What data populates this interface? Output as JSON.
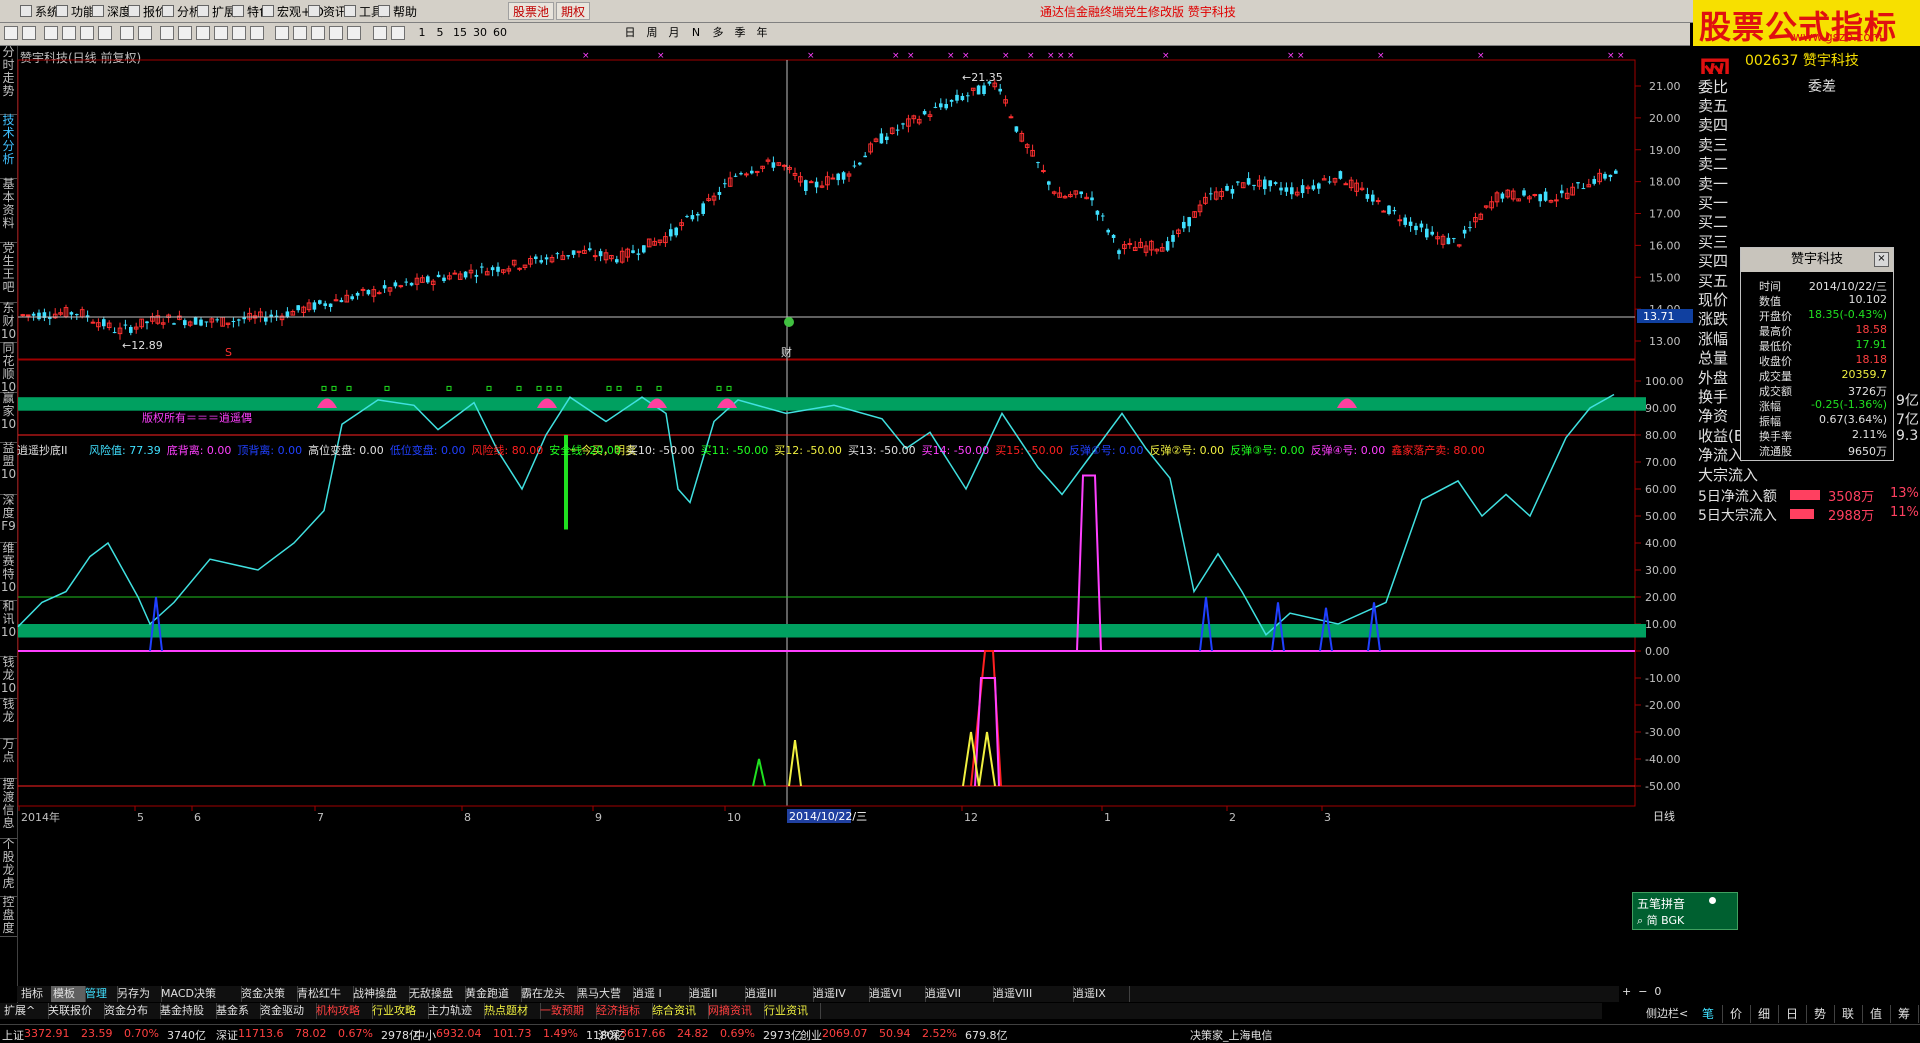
{
  "menu": {
    "items": [
      "系统",
      "功能",
      "深度",
      "报价",
      "分析",
      "扩展",
      "特色",
      "宏观+ID",
      "资讯",
      "工具",
      "帮助"
    ],
    "tab_stockpool": "股票池",
    "tab_options": "期权",
    "app_title": "通达信金融终端党生修改版    赞宇科技"
  },
  "logo": {
    "text": "股票公式指标网",
    "url": "www.gszb.com"
  },
  "toolbar": {
    "periods": [
      "1",
      "5",
      "15",
      "30",
      "60"
    ],
    "periods2": [
      "日",
      "周",
      "月",
      "N",
      "多",
      "季",
      "年"
    ]
  },
  "sidebar": {
    "tabs": [
      "分时走势",
      "技术分析",
      "基本资料",
      "党生王吧",
      "东财10",
      "同花顺10",
      "赢家10",
      "益盟10",
      "深度F9",
      "维赛特10",
      "和讯10",
      "钱龙10",
      "钱龙",
      "万点",
      "摆渡信息",
      "个股龙虎",
      "控盘度"
    ]
  },
  "chart": {
    "title": "赞宇科技(日线 前复权)",
    "stock_header": "002637 赞宇科技",
    "high_label": "21.35",
    "low_label": "12.89",
    "current_price_tag": "13.71",
    "price_axis": [
      "21.00",
      "20.00",
      "19.00",
      "18.00",
      "17.00",
      "16.00",
      "15.00",
      "14.00",
      "13.00"
    ],
    "marker_s": "S",
    "marker_cai": "财"
  },
  "indicator": {
    "name": "逍遥抄底II",
    "params": [
      {
        "text": "风险值: 77.39",
        "color": "#40e0ff"
      },
      {
        "text": "底背离: 0.00",
        "color": "#ff40ff"
      },
      {
        "text": "顶背离: 0.00",
        "color": "#2040ff"
      },
      {
        "text": "高位变盘: 0.00",
        "color": "#e0e0e0"
      },
      {
        "text": "低位变盘: 0.00",
        "color": "#2040ff"
      },
      {
        "text": "风险线: 80.00",
        "color": "#ff2020"
      },
      {
        "text": "安全线: 20.00",
        "color": "#20ff20"
      },
      {
        "text": "买10: -50.00",
        "color": "#e0e0e0"
      },
      {
        "text": "买11: -50.00",
        "color": "#20ff20"
      },
      {
        "text": "买12: -50.00",
        "color": "#f0f040"
      },
      {
        "text": "买13: -50.00",
        "color": "#e0e0e0"
      },
      {
        "text": "买14: -50.00",
        "color": "#ff40ff"
      },
      {
        "text": "买15: -50.00",
        "color": "#ff2020"
      },
      {
        "text": "反弹①号: 0.00",
        "color": "#2040ff"
      },
      {
        "text": "反弹②号: 0.00",
        "color": "#f0f040"
      },
      {
        "text": "反弹③号: 0.00",
        "color": "#20ff20"
      },
      {
        "text": "反弹④号: 0.00",
        "color": "#ff40ff"
      },
      {
        "text": "鑫家落产卖: 80.00",
        "color": "#ff2020"
      }
    ],
    "copyright": "版权所有＝＝＝逍遥偶",
    "sell_note": "一今买，明卖",
    "axis": [
      "100.00",
      "90.00",
      "80.00",
      "70.00",
      "60.00",
      "50.00",
      "40.00",
      "30.00",
      "20.00",
      "10.00",
      "0.00",
      "-10.00",
      "-20.00",
      "-30.00",
      "-40.00",
      "-50.00"
    ]
  },
  "timeaxis": {
    "labels": [
      "2014年",
      "5",
      "6",
      "7",
      "8",
      "9",
      "10",
      "12",
      "1",
      "2",
      "3"
    ],
    "cursor_date": "2014/10/22/三",
    "dayline": "日线"
  },
  "rightpanel": {
    "head1": "委比",
    "head2": "委差",
    "rows": [
      "卖五",
      "卖四",
      "卖三",
      "卖二",
      "卖一",
      "买一",
      "买二",
      "买三",
      "买四",
      "买五",
      "现价",
      "涨跌",
      "涨幅",
      "总量",
      "外盘",
      "换手",
      "净资",
      "收益(B)",
      "净流入",
      "大宗流入"
    ],
    "side_vals": [
      "9亿",
      "7亿",
      "9.3"
    ],
    "flow1_label": "5日净流入额",
    "flow1_val": "3508万",
    "flow1_pct": "13%",
    "flow2_label": "5日大宗流入",
    "flow2_val": "2988万",
    "flow2_pct": "11%"
  },
  "infobox": {
    "title": "赞宇科技",
    "close": "×",
    "rows": [
      {
        "label": "时间",
        "value": "2014/10/22/三",
        "color": "#e0e0e0"
      },
      {
        "label": "数值",
        "value": "10.102",
        "color": "#e0e0e0"
      },
      {
        "label": "开盘价",
        "value": "18.35(-0.43%)",
        "color": "#20e020"
      },
      {
        "label": "最高价",
        "value": "18.58",
        "color": "#ff4040"
      },
      {
        "label": "最低价",
        "value": "17.91",
        "color": "#20e020"
      },
      {
        "label": "收盘价",
        "value": "18.18",
        "color": "#ff4040"
      },
      {
        "label": "成交量",
        "value": "20359.7",
        "color": "#f0f040"
      },
      {
        "label": "成交额",
        "value": "3726万",
        "color": "#e0e0e0"
      },
      {
        "label": "涨幅",
        "value": "-0.25(-1.36%)",
        "color": "#20e020"
      },
      {
        "label": "振幅",
        "value": "0.67(3.64%)",
        "color": "#e0e0e0"
      },
      {
        "label": "换手率",
        "value": "2.11%",
        "color": "#e0e0e0"
      },
      {
        "label": "流通股",
        "value": "9650万",
        "color": "#e0e0e0"
      }
    ]
  },
  "wubi": {
    "title": "五笔拼音",
    "sub": "简 BGK"
  },
  "bottom": {
    "row1": [
      "指标",
      "模板",
      "管理",
      "另存为",
      "MACD决策",
      "资金决策",
      "青松红牛",
      "战神操盘",
      "无敌操盘",
      "黄金跑道",
      "霸在龙头",
      "黑马大营",
      "逍遥 I",
      "逍遥II",
      "逍遥III",
      "逍遥IV",
      "逍遥VI",
      "逍遥VII",
      "逍遥VIII",
      "逍遥IX"
    ],
    "row2": [
      "扩展^",
      "关联报价",
      "资金分布",
      "基金持股",
      "基金系",
      "资金驱动",
      "机构攻略",
      "行业攻略",
      "主力轨迹",
      "热点题材",
      "一致预期",
      "经济指标",
      "综合资讯",
      "网摘资讯",
      "行业资讯"
    ],
    "side_label": "侧边栏<",
    "right_tabs": [
      "笔",
      "价",
      "细",
      "日",
      "势",
      "联",
      "值",
      "筹"
    ]
  },
  "status": {
    "sh": {
      "name": "上证",
      "val": "3372.91",
      "chg": "23.59",
      "pct": "0.70%",
      "amt": "3740亿"
    },
    "sz": {
      "name": "深证",
      "val": "11713.6",
      "chg": "78.02",
      "pct": "0.67%",
      "amt": "2978亿"
    },
    "zx": {
      "name": "中小",
      "val": "6932.04",
      "chg": "101.73",
      "pct": "1.49%",
      "amt": "1180亿"
    },
    "hs": {
      "name": "沪深",
      "val": "3617.66",
      "chg": "24.82",
      "pct": "0.69%",
      "amt": "2973亿"
    },
    "cy": {
      "name": "创业",
      "val": "2069.07",
      "chg": "50.94",
      "pct": "2.52%",
      "amt": "679.8亿"
    },
    "broker": "决策家_上海电信"
  },
  "colors": {
    "up": "#ff3030",
    "down": "#40e0ff",
    "band": "#00a060",
    "curve": "#40e0e0"
  }
}
